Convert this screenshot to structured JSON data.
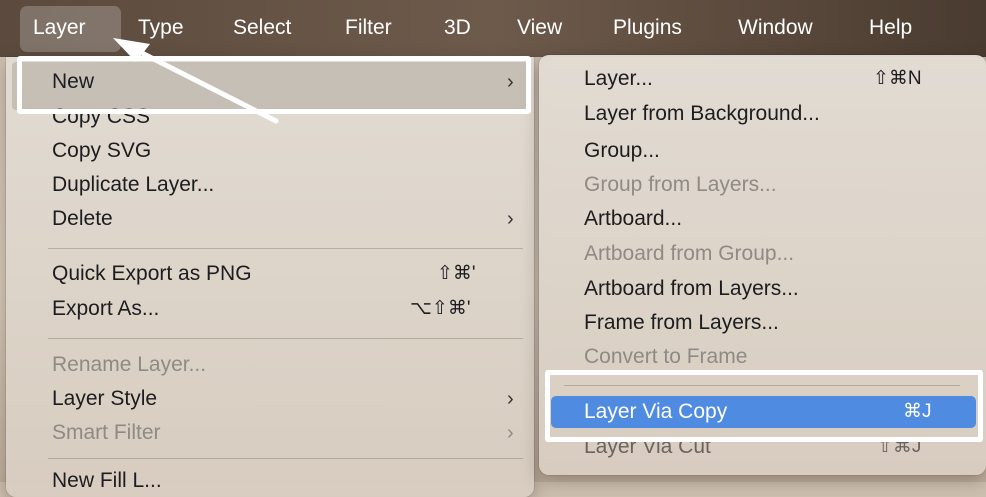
{
  "menubar": {
    "items": [
      "Layer",
      "Type",
      "Select",
      "Filter",
      "3D",
      "View",
      "Plugins",
      "Window",
      "Help"
    ],
    "active": "Layer"
  },
  "layer_menu": {
    "items": [
      {
        "label": "New",
        "submenu": true,
        "disabled": false
      },
      {
        "label": "Copy CSS",
        "disabled": false
      },
      {
        "label": "Copy SVG",
        "disabled": false
      },
      {
        "label": "Duplicate Layer...",
        "disabled": false
      },
      {
        "label": "Delete",
        "submenu": true,
        "disabled": false
      },
      {
        "label": "Quick Export as PNG",
        "shortcut": "⇧⌘'",
        "disabled": false
      },
      {
        "label": "Export As...",
        "shortcut": "⌥⇧⌘'",
        "disabled": false
      },
      {
        "label": "Rename Layer...",
        "disabled": true
      },
      {
        "label": "Layer Style",
        "submenu": true,
        "disabled": false
      },
      {
        "label": "Smart Filter",
        "submenu": true,
        "disabled": true
      },
      {
        "label": "New Fill L...",
        "disabled": false
      }
    ],
    "chevron": "›"
  },
  "new_submenu": {
    "items": [
      {
        "label": "Layer...",
        "shortcut": "⇧⌘N",
        "disabled": false
      },
      {
        "label": "Layer from Background...",
        "disabled": false
      },
      {
        "label": "Group...",
        "disabled": false
      },
      {
        "label": "Group from Layers...",
        "disabled": true
      },
      {
        "label": "Artboard...",
        "disabled": false
      },
      {
        "label": "Artboard from Group...",
        "disabled": true
      },
      {
        "label": "Artboard from Layers...",
        "disabled": false
      },
      {
        "label": "Frame from Layers...",
        "disabled": false
      },
      {
        "label": "Convert to Frame",
        "disabled": true
      },
      {
        "label": "Layer Via Copy",
        "shortcut": "⌘J",
        "highlighted": true
      },
      {
        "label": "Layer Via Cut",
        "shortcut": "⇧⌘J",
        "disabled": false
      }
    ]
  },
  "colors": {
    "highlight": "#4f8be0",
    "callout": "#ffffff",
    "menubar": "#5b4a3d"
  }
}
